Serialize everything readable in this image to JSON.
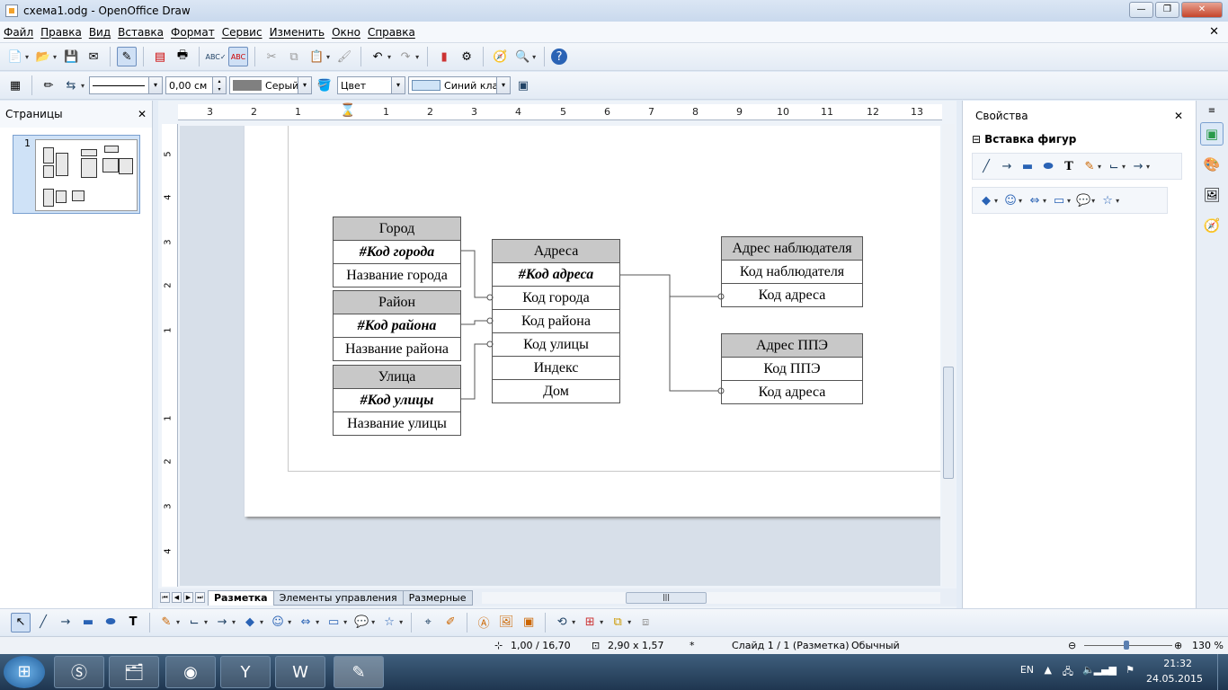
{
  "window": {
    "title": "схема1.odg - OpenOffice Draw"
  },
  "menu": [
    "Файл",
    "Правка",
    "Вид",
    "Вставка",
    "Формат",
    "Сервис",
    "Изменить",
    "Окно",
    "Справка"
  ],
  "line_props": {
    "width_value": "0,00 см",
    "line_color": "Серый",
    "area_style": "Цвет",
    "area_color": "Синий кла"
  },
  "pages_panel": {
    "title": "Страницы",
    "page_number": "1"
  },
  "properties_panel": {
    "title": "Свойства",
    "section": "Вставка фигур"
  },
  "diagram": {
    "gorod": {
      "header": "Город",
      "key": "#Код города",
      "field": "Название города"
    },
    "raion": {
      "header": "Район",
      "key": "#Код района",
      "field": "Название района"
    },
    "ulica": {
      "header": "Улица",
      "key": "#Код улицы",
      "field": "Название улицы"
    },
    "adresa": {
      "header": "Адреса",
      "key": "#Код адреса",
      "fields": [
        "Код города",
        "Код района",
        "Код улицы",
        "Индекс",
        "Дом"
      ]
    },
    "nabl": {
      "header": "Адрес наблюдателя",
      "fields": [
        "Код наблюдателя",
        "Код адреса"
      ]
    },
    "ppe": {
      "header": "Адрес ППЭ",
      "fields": [
        "Код ППЭ",
        "Код адреса"
      ]
    }
  },
  "ruler_h": [
    "3",
    "2",
    "1",
    "1",
    "2",
    "3",
    "4",
    "5",
    "6",
    "7",
    "8",
    "9",
    "10",
    "11",
    "12",
    "13"
  ],
  "ruler_v": [
    "5",
    "4",
    "3",
    "2",
    "1",
    "1",
    "2",
    "3",
    "4"
  ],
  "tabs": [
    "Разметка",
    "Элементы управления",
    "Размерные"
  ],
  "status": {
    "position": "1,00 / 16,70",
    "size": "2,90 x 1,57",
    "modified": "*",
    "slide": "Слайд 1 / 1 (Разметка)",
    "layout": "Обычный",
    "zoom": "130 %"
  },
  "taskbar": {
    "lang": "EN",
    "time": "21:32",
    "date": "24.05.2015"
  },
  "colors": {
    "header_fill": "#c8c8c8",
    "selection": "#cfe0f5"
  }
}
